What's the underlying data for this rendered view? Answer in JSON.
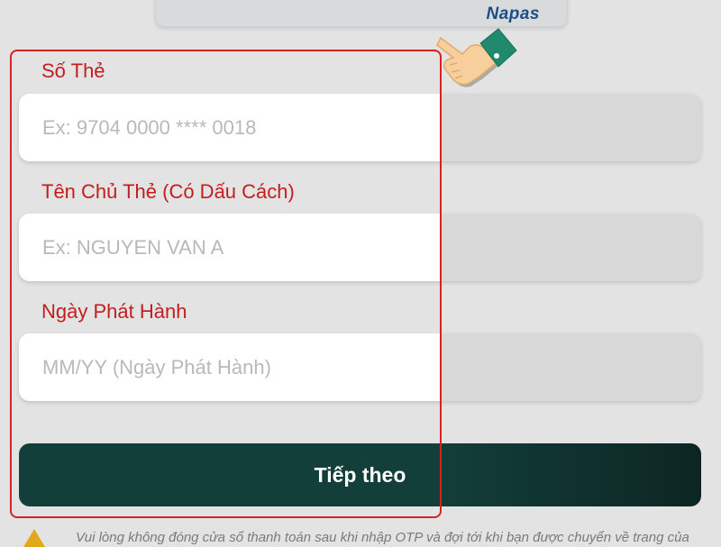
{
  "banner": {
    "brand": "Napas"
  },
  "form": {
    "card_number": {
      "label": "Số Thẻ",
      "placeholder": "Ex: 9704 0000 **** 0018",
      "value": ""
    },
    "card_holder": {
      "label": "Tên Chủ Thẻ (Có Dấu Cách)",
      "placeholder": "Ex: NGUYEN VAN A",
      "value": ""
    },
    "issue_date": {
      "label": "Ngày Phát Hành",
      "placeholder": "MM/YY (Ngày Phát Hành)",
      "value": ""
    },
    "next_label": "Tiếp theo"
  },
  "notice": {
    "icon": "warning-icon",
    "text": "Vui lòng không đóng cửa sổ thanh toán sau khi nhập OTP và đợi tới khi bạn được chuyển về trang của"
  },
  "overlay": {
    "pointer_icon": "pointing-hand-icon",
    "highlight_color": "#d62222"
  }
}
